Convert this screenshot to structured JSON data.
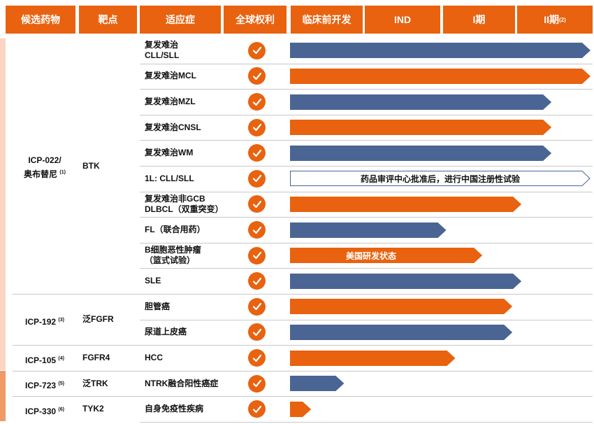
{
  "colors": {
    "orange": "#e8620f",
    "blue": "#4a6593",
    "stripe_light": "#fbd5c2",
    "stripe_dark": "#f09a66"
  },
  "headers": [
    {
      "label": "候选药物",
      "sup": ""
    },
    {
      "label": "靶点",
      "sup": ""
    },
    {
      "label": "适应症",
      "sup": ""
    },
    {
      "label": "全球权利",
      "sup": ""
    },
    {
      "label": "临床前开发",
      "sup": ""
    },
    {
      "label": "IND",
      "sup": ""
    },
    {
      "label": "I期",
      "sup": ""
    },
    {
      "label": "II期",
      "sup": "(2)"
    }
  ],
  "drugs": [
    {
      "name": "ICP-022/",
      "name2": "奥布替尼",
      "sup": "(1)",
      "target": "BTK"
    },
    {
      "name": "ICP-192",
      "name2": "",
      "sup": "(3)",
      "target": "泛FGFR"
    },
    {
      "name": "ICP-105",
      "name2": "",
      "sup": "(4)",
      "target": "FGFR4"
    },
    {
      "name": "ICP-723",
      "name2": "",
      "sup": "(5)",
      "target": "泛TRK"
    },
    {
      "name": "ICP-330",
      "name2": "",
      "sup": "(6)",
      "target": "TYK2"
    }
  ],
  "rows": [
    {
      "indication": "复发难治",
      "indication2": "CLL/SLL",
      "color": "blue",
      "progress": 1.0,
      "label": ""
    },
    {
      "indication": "复发难治MCL",
      "indication2": "",
      "color": "orange",
      "progress": 1.0,
      "label": ""
    },
    {
      "indication": "复发难治MZL",
      "indication2": "",
      "color": "blue",
      "progress": 0.87,
      "label": ""
    },
    {
      "indication": "复发难治CNSL",
      "indication2": "",
      "color": "orange",
      "progress": 0.87,
      "label": ""
    },
    {
      "indication": "复发难治WM",
      "indication2": "",
      "color": "blue",
      "progress": 0.87,
      "label": ""
    },
    {
      "indication": "1L: CLL/SLL",
      "indication2": "",
      "color": "outline",
      "progress": 1.0,
      "label": "药品审评中心批准后，进行中国注册性试验"
    },
    {
      "indication": "复发难治非GCB",
      "indication2": "DLBCL（双重突变）",
      "color": "orange",
      "progress": 0.77,
      "label": ""
    },
    {
      "indication": "FL（联合用药）",
      "indication2": "",
      "color": "blue",
      "progress": 0.52,
      "label": ""
    },
    {
      "indication": "B细胞恶性肿瘤",
      "indication2": "（篮式试验）",
      "color": "orange",
      "progress": 0.64,
      "label": "美国研发状态"
    },
    {
      "indication": "SLE",
      "indication2": "",
      "color": "blue",
      "progress": 0.77,
      "label": ""
    },
    {
      "indication": "胆管癌",
      "indication2": "",
      "color": "orange",
      "progress": 0.74,
      "label": ""
    },
    {
      "indication": "尿道上皮癌",
      "indication2": "",
      "color": "blue",
      "progress": 0.74,
      "label": ""
    },
    {
      "indication": "HCC",
      "indication2": "",
      "color": "orange",
      "progress": 0.55,
      "label": ""
    },
    {
      "indication": "NTRK融合阳性癌症",
      "indication2": "",
      "color": "blue",
      "progress": 0.18,
      "label": ""
    },
    {
      "indication": "自身免疫性疾病",
      "indication2": "",
      "color": "orange",
      "progress": 0.07,
      "label": ""
    }
  ]
}
